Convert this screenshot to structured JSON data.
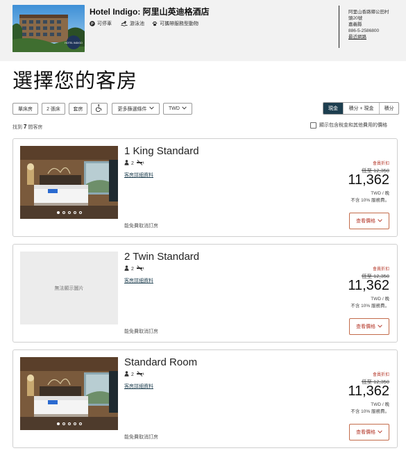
{
  "hotel": {
    "name": "Hotel Indigo: 阿里山英迪格酒店",
    "logo_text": "HOTEL INDIGO",
    "amenities": [
      {
        "icon": "parking-icon",
        "label": "可停車"
      },
      {
        "icon": "swimming-icon",
        "label": "游泳池"
      },
      {
        "icon": "paw-icon",
        "label": "可攜帶服務型動物"
      }
    ],
    "address": {
      "line1": "阿里山香路鄉公田村",
      "line2": "頭20號",
      "line3": "嘉義縣",
      "phone": "886-5-2586800",
      "directions": "最近網路"
    }
  },
  "page_title": "選擇您的客房",
  "filters": {
    "single_bed": "單床房",
    "two_beds": "2 張床",
    "suite": "套房",
    "accessible_icon": "wheelchair-icon",
    "more_filters": "更多篩選條件",
    "currency": "TWD",
    "payment_tabs": [
      "現金",
      "積分 + 現金",
      "積分"
    ],
    "active_tab": "現金"
  },
  "results": {
    "prefix": "找到",
    "count": "7",
    "suffix": "間客房",
    "tax_toggle": "顯示包含稅金和其他費用的價格"
  },
  "rooms": [
    {
      "name": "1 King Standard",
      "guests": "2",
      "details_link": "客房詳細資料",
      "cancel_text": "能免費取消訂房",
      "badge": "會員折扣",
      "original_price": "低至 12,350",
      "price": "11,362",
      "per_night": "TWD / 晚",
      "tax_note": "不含 10% 服務費。",
      "button": "查看價格",
      "image": "photo",
      "no_image_text": ""
    },
    {
      "name": "2 Twin Standard",
      "guests": "2",
      "details_link": "客房詳細資料",
      "cancel_text": "能免費取消訂房",
      "badge": "會員折扣",
      "original_price": "低至 12,350",
      "price": "11,362",
      "per_night": "TWD / 晚",
      "tax_note": "不含 10% 服務費。",
      "button": "查看價格",
      "image": "none",
      "no_image_text": "無法顯示圖片"
    },
    {
      "name": "Standard Room",
      "guests": "2",
      "details_link": "客房詳細資料",
      "cancel_text": "能免費取消訂房",
      "badge": "會員折扣",
      "original_price": "低至 12,350",
      "price": "11,362",
      "per_night": "TWD / 晚",
      "tax_note": "不含 10% 服務費。",
      "button": "查看價格",
      "image": "photo",
      "no_image_text": ""
    }
  ],
  "colors": {
    "header_bg": "#f2f2f2",
    "accent_dark": "#1d3e4f",
    "accent_red": "#b5382a"
  }
}
